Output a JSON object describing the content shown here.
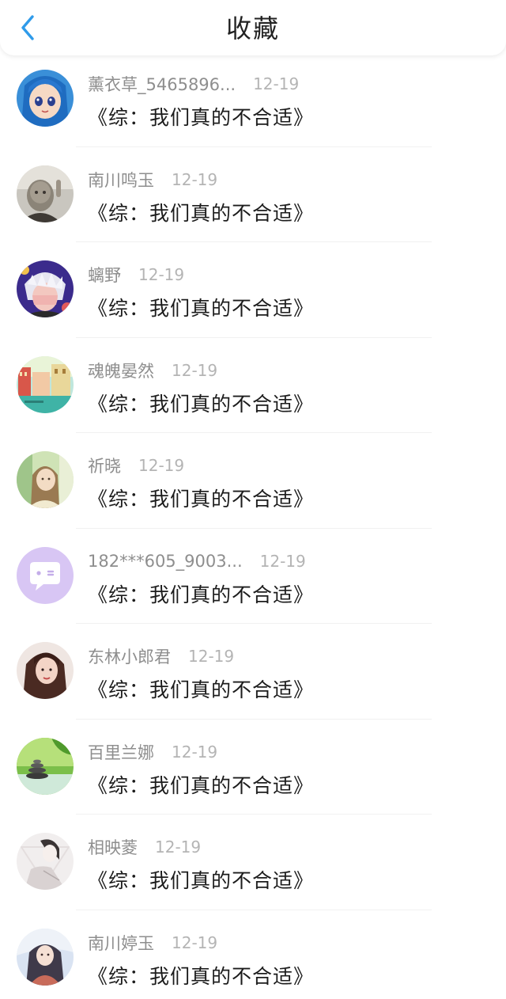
{
  "header": {
    "title": "收藏",
    "back_icon": "chevron-left-icon",
    "accent_color": "#2f9bea"
  },
  "items": [
    {
      "username": "薰衣草_5465896...",
      "date": "12-19",
      "book": "《综：我们真的不合适》",
      "avatar": "anime-blue-hair-avatar"
    },
    {
      "username": "南川鸣玉",
      "date": "12-19",
      "book": "《综：我们真的不合适》",
      "avatar": "person-photo-avatar"
    },
    {
      "username": "螭野",
      "date": "12-19",
      "book": "《综：我们真的不合适》",
      "avatar": "anime-white-hair-avatar"
    },
    {
      "username": "魂魄晏然",
      "date": "12-19",
      "book": "《综：我们真的不合适》",
      "avatar": "canal-scenery-avatar"
    },
    {
      "username": "祈晓",
      "date": "12-19",
      "book": "《综：我们真的不合适》",
      "avatar": "girl-photo-avatar"
    },
    {
      "username": "182***605_9003...",
      "date": "12-19",
      "book": "《综：我们真的不合适》",
      "avatar": "default-chat-bubble-avatar"
    },
    {
      "username": "东林小郎君",
      "date": "12-19",
      "book": "《综：我们真的不合适》",
      "avatar": "woman-portrait-avatar"
    },
    {
      "username": "百里兰娜",
      "date": "12-19",
      "book": "《综：我们真的不合适》",
      "avatar": "zen-stones-bamboo-avatar"
    },
    {
      "username": "相映菱",
      "date": "12-19",
      "book": "《综：我们真的不合适》",
      "avatar": "sketch-portrait-avatar"
    },
    {
      "username": "南川婷玉",
      "date": "12-19",
      "book": "《综：我们真的不合适》",
      "avatar": "illustrated-girl-avatar"
    }
  ]
}
